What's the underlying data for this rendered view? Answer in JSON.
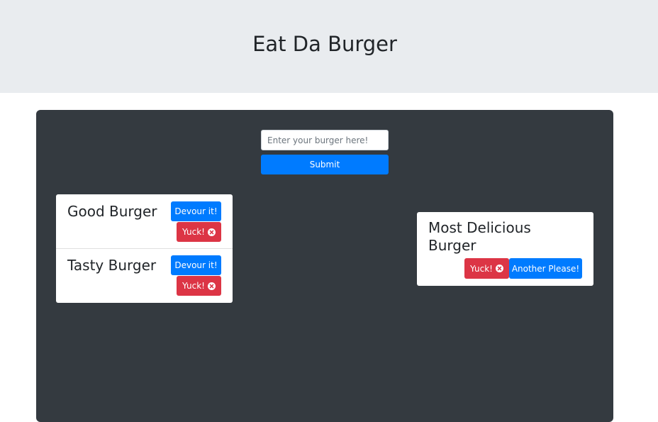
{
  "header": {
    "title": "Eat Da Burger"
  },
  "form": {
    "placeholder": "Enter your burger here!",
    "value": "",
    "submit_label": "Submit"
  },
  "not_devoured": [
    {
      "name": "Good Burger",
      "devour_label": "Devour it!",
      "yuck_label": "Yuck!"
    },
    {
      "name": "Tasty Burger",
      "devour_label": "Devour it!",
      "yuck_label": "Yuck!"
    }
  ],
  "devoured": [
    {
      "name_line1": "Most Delicious",
      "name_line2": "Burger",
      "yuck_label": "Yuck!",
      "another_label": "Another Please!"
    }
  ],
  "icons": {
    "yuck": "circle-x-icon"
  },
  "colors": {
    "header_bg": "#e9ecef",
    "panel_bg": "#343a40",
    "primary": "#007bff",
    "danger": "#dc3545"
  }
}
